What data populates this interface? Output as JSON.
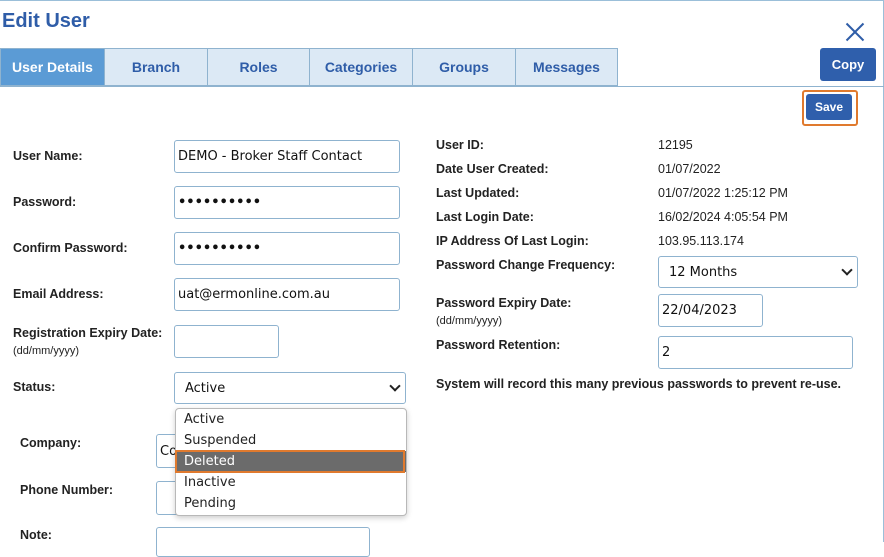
{
  "dialog": {
    "title": "Edit User"
  },
  "tabs": [
    {
      "label": "User Details",
      "active": true
    },
    {
      "label": "Branch",
      "active": false
    },
    {
      "label": "Roles",
      "active": false
    },
    {
      "label": "Categories",
      "active": false
    },
    {
      "label": "Groups",
      "active": false
    },
    {
      "label": "Messages",
      "active": false
    }
  ],
  "actions": {
    "copy_label": "Copy",
    "save_label": "Save"
  },
  "form": {
    "user_name": {
      "label": "User Name:",
      "value": "DEMO - Broker Staff Contact"
    },
    "password": {
      "label": "Password:",
      "value": "••••••••••"
    },
    "confirm_password": {
      "label": "Confirm Password:",
      "value": "••••••••••"
    },
    "email": {
      "label": "Email Address:",
      "value": "uat@ermonline.com.au"
    },
    "reg_expiry": {
      "label": "Registration Expiry Date:",
      "sublabel": "(dd/mm/yyyy)",
      "value": ""
    },
    "status": {
      "label": "Status:",
      "value": "Active",
      "options": [
        "Active",
        "Suspended",
        "Deleted",
        "Inactive",
        "Pending"
      ],
      "highlighted": "Deleted"
    },
    "company": {
      "label": "Company:",
      "value_partial": "Co"
    },
    "phone": {
      "label": "Phone Number:",
      "value": ""
    },
    "note": {
      "label": "Note:",
      "value": ""
    }
  },
  "info": {
    "user_id": {
      "label": "User ID:",
      "value": "12195"
    },
    "date_created": {
      "label": "Date User Created:",
      "value": "01/07/2022"
    },
    "last_updated": {
      "label": "Last Updated:",
      "value": "01/07/2022 1:25:12 PM"
    },
    "last_login": {
      "label": "Last Login Date:",
      "value": "16/02/2024 4:05:54 PM"
    },
    "ip_last_login": {
      "label": "IP Address Of Last Login:",
      "value": "103.95.113.174"
    },
    "pwd_change_freq": {
      "label": "Password Change Frequency:",
      "value": "12 Months"
    },
    "pwd_expiry": {
      "label": "Password Expiry Date:",
      "sublabel": "(dd/mm/yyyy)",
      "value": "22/04/2023"
    },
    "pwd_retention": {
      "label": "Password Retention:",
      "value": "2"
    },
    "retention_note": "System will record this many previous passwords to prevent re-use."
  },
  "colors": {
    "accent": "#2f5da8",
    "tab_active": "#5b9bd5",
    "tab_bg": "#dce9f5",
    "highlight": "#e07a2e"
  }
}
